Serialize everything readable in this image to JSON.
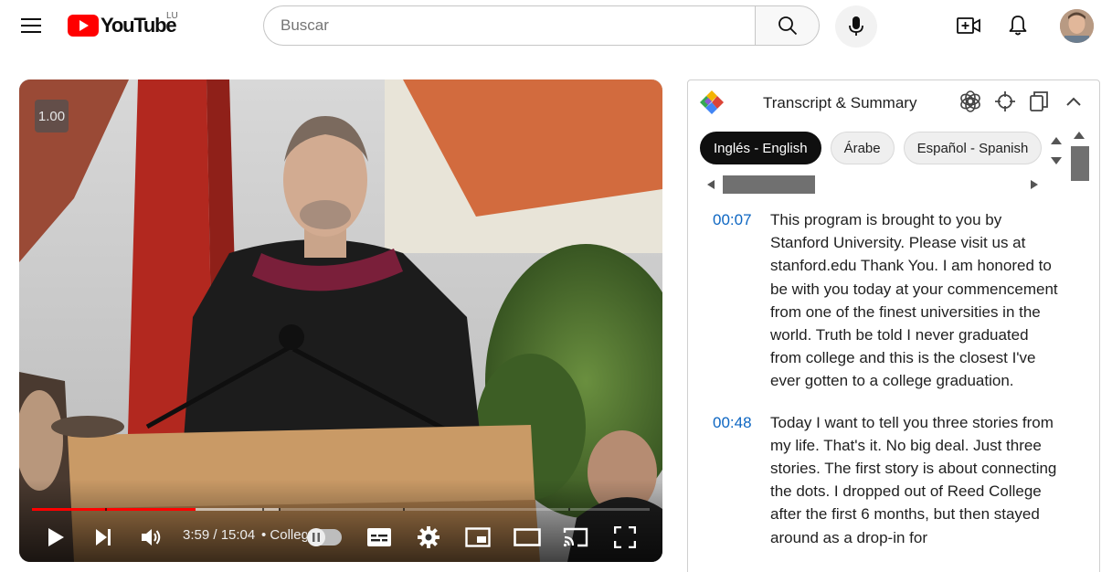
{
  "header": {
    "logo_text": "YouTube",
    "country_code": "LU",
    "search_placeholder": "Buscar",
    "icons": [
      "menu-icon",
      "search-icon",
      "mic-icon",
      "create-icon",
      "bell-icon",
      "avatar"
    ]
  },
  "player": {
    "speed_label": "1.00",
    "time_display": "3:59 / 15:04",
    "chapter_label": "• College",
    "progress": {
      "played_fraction": 0.2647,
      "buffered_fraction": 0.4
    },
    "colors": {
      "played": "#ff0000"
    }
  },
  "transcript_panel": {
    "title": "Transcript & Summary",
    "languages": [
      {
        "label": "Inglés - English",
        "selected": true
      },
      {
        "label": "Árabe",
        "selected": false
      },
      {
        "label": "Español - Spanish",
        "selected": false
      }
    ],
    "entries": [
      {
        "time": "00:07",
        "text": "This program is brought to you by Stanford University. Please visit us at stanford.edu Thank You. I am honored to be with you today at your commencement from one of the finest universities in the world. Truth be told I never graduated from college and this is the closest I've ever gotten to a college graduation."
      },
      {
        "time": "00:48",
        "text": "Today I want to tell you three stories from my life. That's it. No big deal. Just three stories. The first story is about connecting the dots. I dropped out of Reed College after the first 6 months, but then stayed around as a drop-in for"
      }
    ],
    "colors": {
      "timestamp": "#0d66c2"
    }
  }
}
